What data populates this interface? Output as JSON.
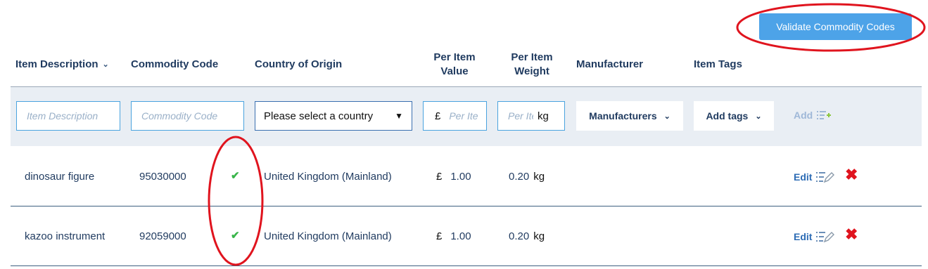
{
  "toolbar": {
    "validate_label": "Validate Commodity Codes"
  },
  "columns": {
    "item_description": "Item Description",
    "commodity_code": "Commodity Code",
    "country_of_origin": "Country of Origin",
    "per_item_value": "Per Item Value",
    "per_item_weight": "Per Item Weight",
    "manufacturer": "Manufacturer",
    "item_tags": "Item Tags"
  },
  "entry": {
    "item_description_placeholder": "Item Description",
    "commodity_code_placeholder": "Commodity Code",
    "country_select": "Please select a country",
    "value_prefix": "£",
    "value_placeholder": "Per Item Value",
    "weight_placeholder": "Per Item Weight",
    "weight_unit": "kg",
    "manufacturers_label": "Manufacturers",
    "add_tags_label": "Add tags",
    "add_label": "Add"
  },
  "rows": [
    {
      "description": "dinosaur figure",
      "commodity_code": "95030000",
      "code_validated": true,
      "country": "United Kingdom (Mainland)",
      "currency": "£",
      "value": "1.00",
      "weight": "0.20",
      "weight_unit": "kg",
      "edit_label": "Edit"
    },
    {
      "description": "kazoo instrument",
      "commodity_code": "92059000",
      "code_validated": true,
      "country": "United Kingdom (Mainland)",
      "currency": "£",
      "value": "1.00",
      "weight": "0.20",
      "weight_unit": "kg",
      "edit_label": "Edit"
    }
  ],
  "colors": {
    "accent": "#4da3e8",
    "header_text": "#1f3a5f",
    "check": "#39b54a",
    "delete": "#e0141e",
    "annotation": "#e0141e"
  },
  "icons": {
    "sort": "chevron-down-icon",
    "validated": "checkmark-icon",
    "edit": "edit-list-pencil-icon",
    "delete": "red-x-icon",
    "add": "list-plus-icon"
  }
}
